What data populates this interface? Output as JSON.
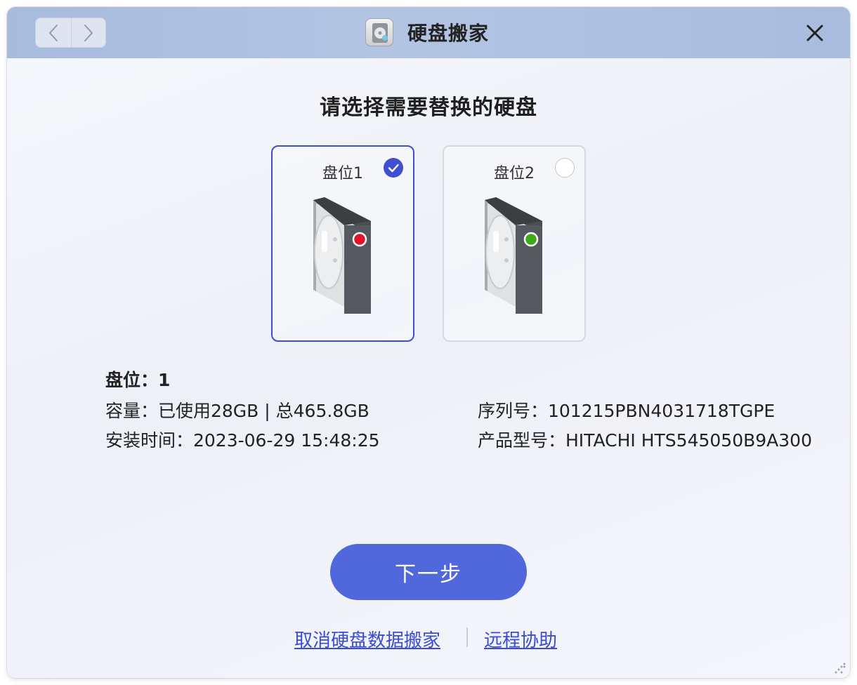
{
  "window": {
    "title": "硬盘搬家",
    "app_icon": "hdd-app-icon"
  },
  "nav": {
    "back_icon": "chevron-left-icon",
    "forward_icon": "chevron-right-icon",
    "close_icon": "close-icon"
  },
  "heading": "请选择需要替换的硬盘",
  "slots": [
    {
      "label": "盘位1",
      "selected": true,
      "led_color": "#e0122c"
    },
    {
      "label": "盘位2",
      "selected": false,
      "led_color": "#3dac14"
    }
  ],
  "details": {
    "slot_line": "盘位：1",
    "capacity": "容量：已使用28GB | 总465.8GB",
    "install_time": "安装时间：2023-06-29 15:48:25",
    "serial": "序列号：101215PBN4031718TGPE",
    "model": "产品型号：HITACHI HTS545050B9A300"
  },
  "actions": {
    "next": "下一步",
    "cancel_link": "取消硬盘数据搬家",
    "remote_link": "远程协助"
  },
  "colors": {
    "accent": "#5168dd",
    "selected_border": "#3f4ed3",
    "titlebar": "#a9bcdd",
    "link": "#3a4bd4"
  }
}
